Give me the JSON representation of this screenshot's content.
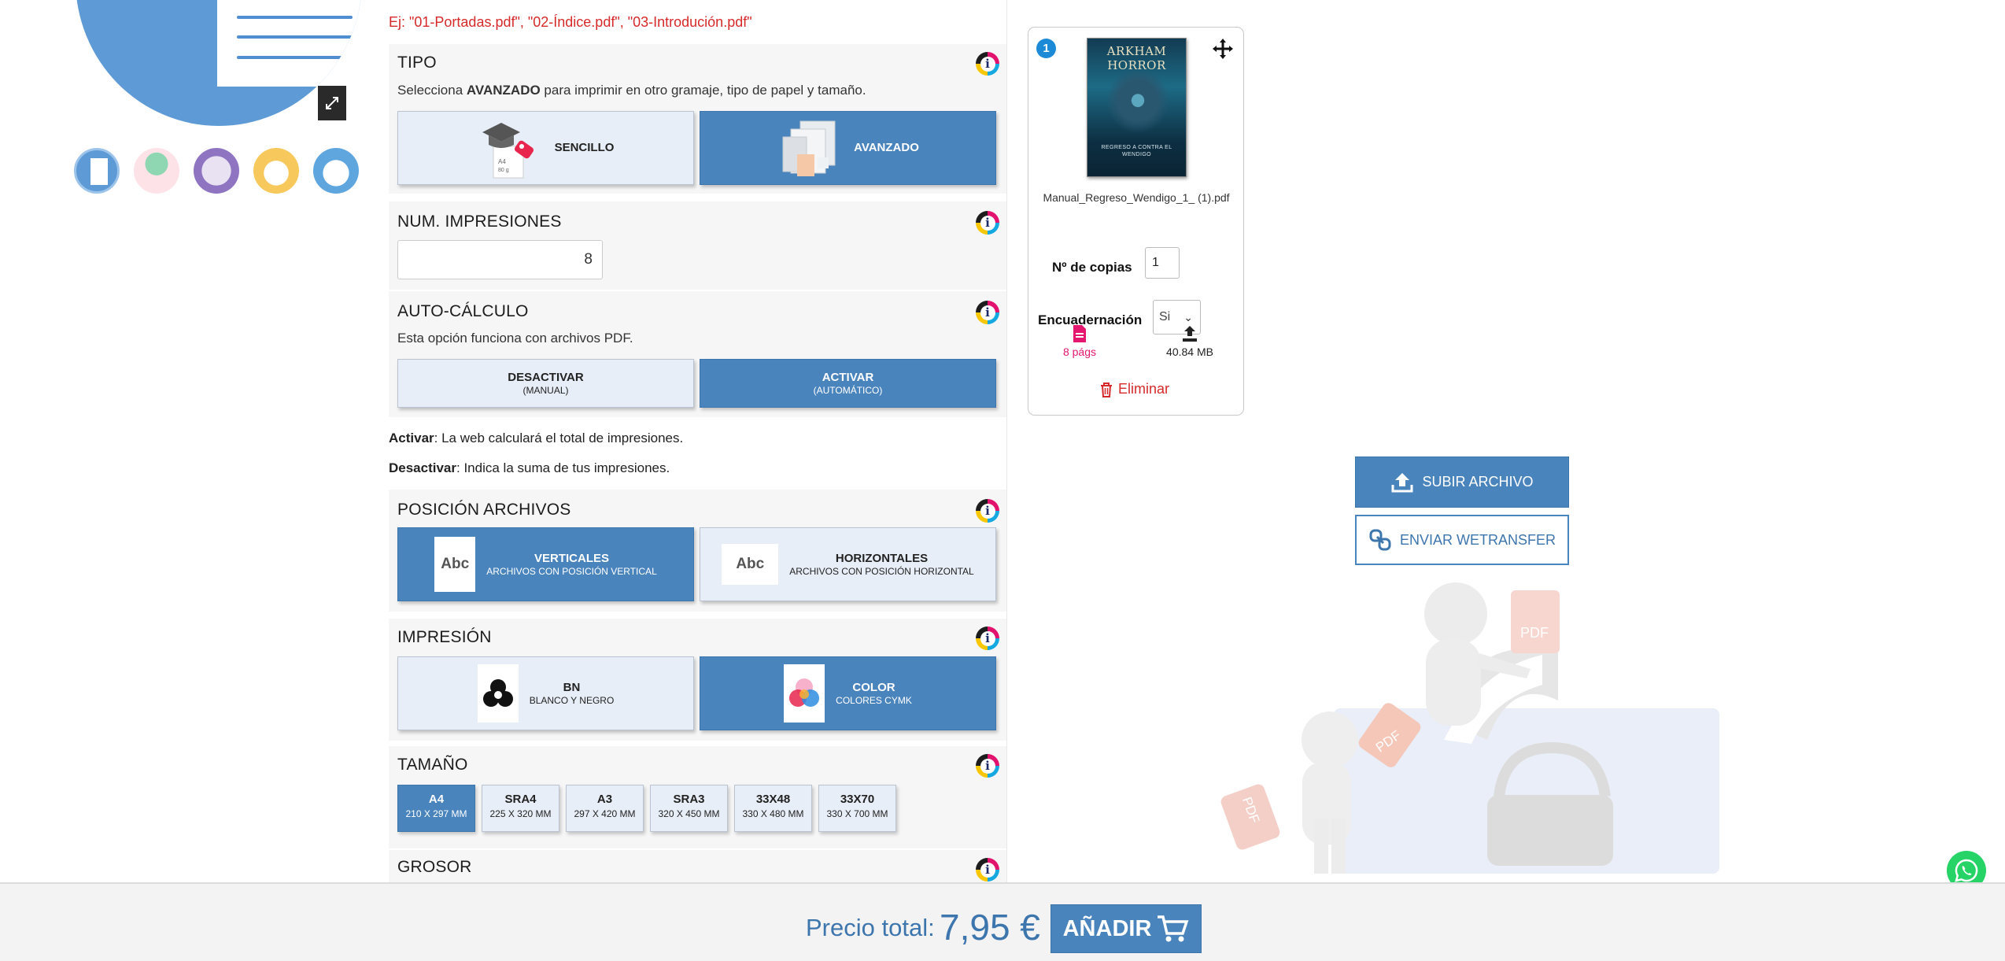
{
  "gallery": {
    "thumbnails": [
      "thumb-document",
      "thumb-infographic-green",
      "thumb-calendar-purple",
      "thumb-chart-yellow",
      "thumb-presentation-blue"
    ]
  },
  "config": {
    "filename_example": "Ej: \"01-Portadas.pdf\", \"02-Índice.pdf\", \"03-Introdución.pdf\"",
    "tipo": {
      "title": "TIPO",
      "desc_pre": "Selecciona ",
      "desc_bold": "AVANZADO",
      "desc_post": " para imprimir en otro gramaje, tipo de papel y tamaño.",
      "options": [
        {
          "label": "SENCILLO",
          "paper": "A4",
          "weight": "80 g",
          "selected": false
        },
        {
          "label": "AVANZADO",
          "selected": true
        }
      ]
    },
    "impresiones": {
      "title": "NUM. IMPRESIONES",
      "value": "8"
    },
    "autocalculo": {
      "title": "AUTO-CÁLCULO",
      "desc": "Esta opción funciona con archivos PDF.",
      "options": [
        {
          "label": "DESACTIVAR",
          "sub": "(MANUAL)",
          "selected": false
        },
        {
          "label": "ACTIVAR",
          "sub": "(AUTOMÁTICO)",
          "selected": true
        }
      ],
      "note_activar_bold": "Activar",
      "note_activar": ": La web calculará el total de impresiones.",
      "note_desactivar_bold": "Desactivar",
      "note_desactivar": ": Indica la suma de tus impresiones."
    },
    "posicion": {
      "title": "POSICIÓN ARCHIVOS",
      "abc": "Abc",
      "options": [
        {
          "label": "VERTICALES",
          "sub": "ARCHIVOS CON POSICIÓN VERTICAL",
          "selected": true
        },
        {
          "label": "HORIZONTALES",
          "sub": "ARCHIVOS CON POSICIÓN HORIZONTAL",
          "selected": false
        }
      ]
    },
    "impresion": {
      "title": "IMPRESIÓN",
      "options": [
        {
          "label": "BN",
          "sub": "BLANCO Y NEGRO",
          "selected": false
        },
        {
          "label": "COLOR",
          "sub": "COLORES CYMK",
          "selected": true
        }
      ]
    },
    "tamano": {
      "title": "TAMAÑO",
      "options": [
        {
          "label": "A4",
          "sub": "210 X 297 MM",
          "selected": true
        },
        {
          "label": "SRA4",
          "sub": "225 X 320 MM",
          "selected": false
        },
        {
          "label": "A3",
          "sub": "297 X 420 MM",
          "selected": false
        },
        {
          "label": "SRA3",
          "sub": "320 X 450 MM",
          "selected": false
        },
        {
          "label": "33X48",
          "sub": "330 X 480 MM",
          "selected": false
        },
        {
          "label": "33X70",
          "sub": "330 X 700 MM",
          "selected": false
        }
      ]
    },
    "grosor": {
      "title": "GROSOR"
    },
    "info_glyph": "i"
  },
  "file_card": {
    "index": "1",
    "cover_title": "ARKHAM HORROR",
    "cover_subtitle": "REGRESO A CONTRA EL WENDIGO",
    "filename": "Manual_Regreso_Wendigo_1_ (1).pdf",
    "copies_label": "Nº de copias",
    "copies_value": "1",
    "binding_label": "Encuadernación",
    "binding_value": "Si",
    "pages": "8 págs",
    "size": "40.84 MB",
    "delete_label": "Eliminar"
  },
  "upload": {
    "upload_label": "SUBIR ARCHIVO",
    "wetransfer_label": "ENVIAR WETRANSFER"
  },
  "illustration": {
    "pdf_tag": "PDF"
  },
  "footer": {
    "price_label": "Precio total:",
    "price_value": "7,95 €",
    "add_label": "AÑADIR"
  },
  "colors": {
    "accent": "#4a84bd",
    "light_option": "#e8eef7",
    "error_red": "#d62a2a",
    "pages_pink": "#e4166f",
    "whatsapp": "#25d366"
  }
}
